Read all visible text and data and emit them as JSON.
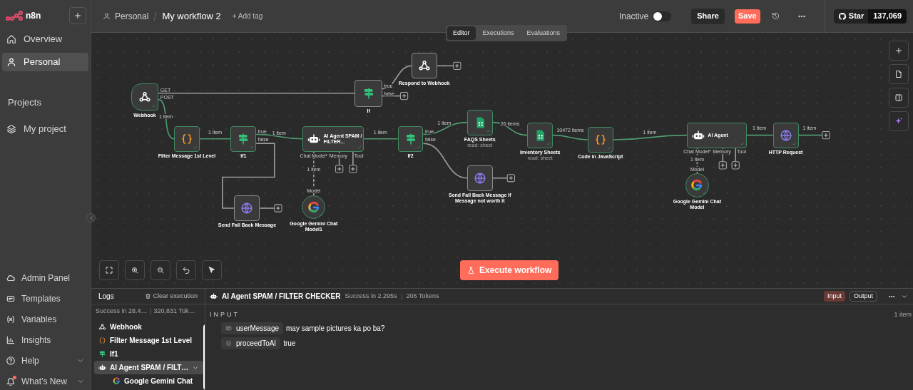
{
  "sidebar": {
    "logo": "n8n",
    "nav": [
      {
        "label": "Overview",
        "selected": false
      },
      {
        "label": "Personal",
        "selected": true
      }
    ],
    "projects_heading": "Projects",
    "projects": [
      {
        "label": "My project"
      }
    ],
    "bottom": [
      {
        "label": "Admin Panel",
        "expandable": false,
        "notification": false
      },
      {
        "label": "Templates",
        "expandable": false,
        "notification": false
      },
      {
        "label": "Variables",
        "expandable": false,
        "notification": false
      },
      {
        "label": "Insights",
        "expandable": false,
        "notification": false
      },
      {
        "label": "Help",
        "expandable": true,
        "notification": false
      },
      {
        "label": "What’s New",
        "expandable": true,
        "notification": true
      }
    ]
  },
  "header": {
    "breadcrumb_project": "Personal",
    "workflow_name": "My workflow 2",
    "add_tag": "+ Add tag",
    "status_label": "Inactive",
    "active": false,
    "share": "Share",
    "save": "Save",
    "github_star": "Star",
    "github_count": "137,069"
  },
  "tabs": [
    {
      "label": "Editor",
      "selected": true
    },
    {
      "label": "Executions",
      "selected": false
    },
    {
      "label": "Evaluations",
      "selected": false
    }
  ],
  "canvas": {
    "nodes": [
      {
        "kind": "webhook",
        "label": "Webhook",
        "executed": true,
        "ports": [
          "GET",
          "POST"
        ]
      },
      {
        "kind": "if",
        "label": "If",
        "executed": false,
        "ports": [
          "true",
          "false"
        ]
      },
      {
        "kind": "webhook",
        "label": "Respond to Webhook",
        "executed": false
      },
      {
        "kind": "code",
        "label": "Filter Message 1st Level",
        "executed": true
      },
      {
        "kind": "if",
        "label": "If1",
        "executed": true,
        "ports": [
          "true",
          "false"
        ]
      },
      {
        "kind": "agent",
        "label": "AI Agent SPAM / FILTER...",
        "executed": true,
        "ports": [
          "Chat Model*",
          "Memory",
          "Tool"
        ]
      },
      {
        "kind": "if",
        "label": "If2",
        "executed": true,
        "ports": [
          "true",
          "false"
        ]
      },
      {
        "kind": "sheets",
        "label": "FAQS Sheets",
        "subtitle": "read: sheet",
        "executed": true
      },
      {
        "kind": "sheets",
        "label": "Inventory Sheets",
        "subtitle": "read: sheet",
        "executed": true
      },
      {
        "kind": "code",
        "label": "Code in JavaScript",
        "executed": true
      },
      {
        "kind": "agent",
        "label": "AI Agent",
        "executed": true,
        "ports": [
          "Chat Model*",
          "Memory",
          "Tool"
        ]
      },
      {
        "kind": "http",
        "label": "HTTP Request",
        "executed": true
      },
      {
        "kind": "http",
        "label": "Send Fall Back Message",
        "executed": false
      },
      {
        "kind": "gemini",
        "label": "Google Gemini Chat Model1",
        "executed": true,
        "ports": [
          "Model"
        ]
      },
      {
        "kind": "http",
        "label": "Send Fall Back Message if Message not worth it",
        "executed": false
      },
      {
        "kind": "gemini",
        "label": "Google Gemini Chat Model",
        "executed": true,
        "ports": [
          "Model"
        ]
      }
    ],
    "connection_labels": [
      "1 item",
      "1 item",
      "1 item",
      "1 item",
      "1 item",
      "26 items",
      "10472 items",
      "1 item",
      "1 item",
      "1 item",
      "1 item",
      "1 item"
    ],
    "execute_button": "Execute workflow"
  },
  "logs": {
    "title": "Logs",
    "clear": "Clear execution",
    "summary_status": "Success in 28.4…",
    "summary_tokens": "320,831 Tok…",
    "entries": [
      {
        "kind": "webhook",
        "label": "Webhook",
        "selected": false
      },
      {
        "kind": "code",
        "label": "Filter Message 1st Level",
        "selected": false
      },
      {
        "kind": "if",
        "label": "If1",
        "selected": false
      },
      {
        "kind": "agent",
        "label": "AI Agent SPAM / FILT…",
        "selected": true,
        "expanded": true,
        "children": [
          {
            "kind": "gemini",
            "label": "Google Gemini Chat",
            "selected": false
          }
        ]
      }
    ],
    "detail": {
      "node_title": "AI Agent SPAM / FILTER CHECKER",
      "status": "Success in 2.295s",
      "tokens": "206 Tokens",
      "view_tabs": [
        {
          "label": "Input",
          "selected": true
        },
        {
          "label": "Output",
          "selected": false
        }
      ],
      "section": "INPUT",
      "item_count": "1 item",
      "fields": [
        {
          "kind": "string",
          "key": "userMessage",
          "value": "may sample pictures ka po ba?"
        },
        {
          "kind": "boolean",
          "key": "proceedToAI",
          "value": "true"
        }
      ]
    }
  }
}
